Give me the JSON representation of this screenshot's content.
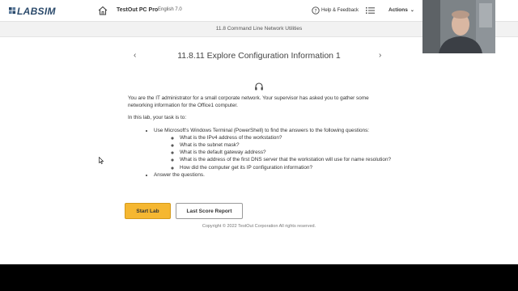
{
  "header": {
    "logo_text": "LABSIM",
    "app_name": "TestOut PC Pro",
    "app_language": "English 7.0",
    "help_label": "Help & Feedback",
    "actions_label": "Actions"
  },
  "breadcrumb": "11.8 Command Line Network Utilities",
  "page": {
    "title": "11.8.11 Explore Configuration Information 1",
    "intro": "You are the IT administrator for a small corporate network. Your supervisor has asked you to gather some networking information for the Office1 computer.",
    "task_intro": "In this lab, your task is to:",
    "tasks": [
      {
        "text": "Use Microsoft's Windows Terminal (PowerShell) to find the answers to the following questions:",
        "questions": [
          "What is the IPv4 address of the workstation?",
          "What is the subnet mask?",
          "What is the default gateway address?",
          "What is the address of the first DNS server that the workstation will use for name resolution?",
          "How did the computer get its IP configuration information?"
        ]
      },
      {
        "text": "Answer the questions."
      }
    ]
  },
  "buttons": {
    "start_lab": "Start Lab",
    "last_score": "Last Score Report"
  },
  "footer": {
    "copyright": "Copyright © 2022 TestOut Corporation  All rights reserved."
  },
  "colors": {
    "brand": "#2b4a6b",
    "start_button": "#f5b731"
  }
}
